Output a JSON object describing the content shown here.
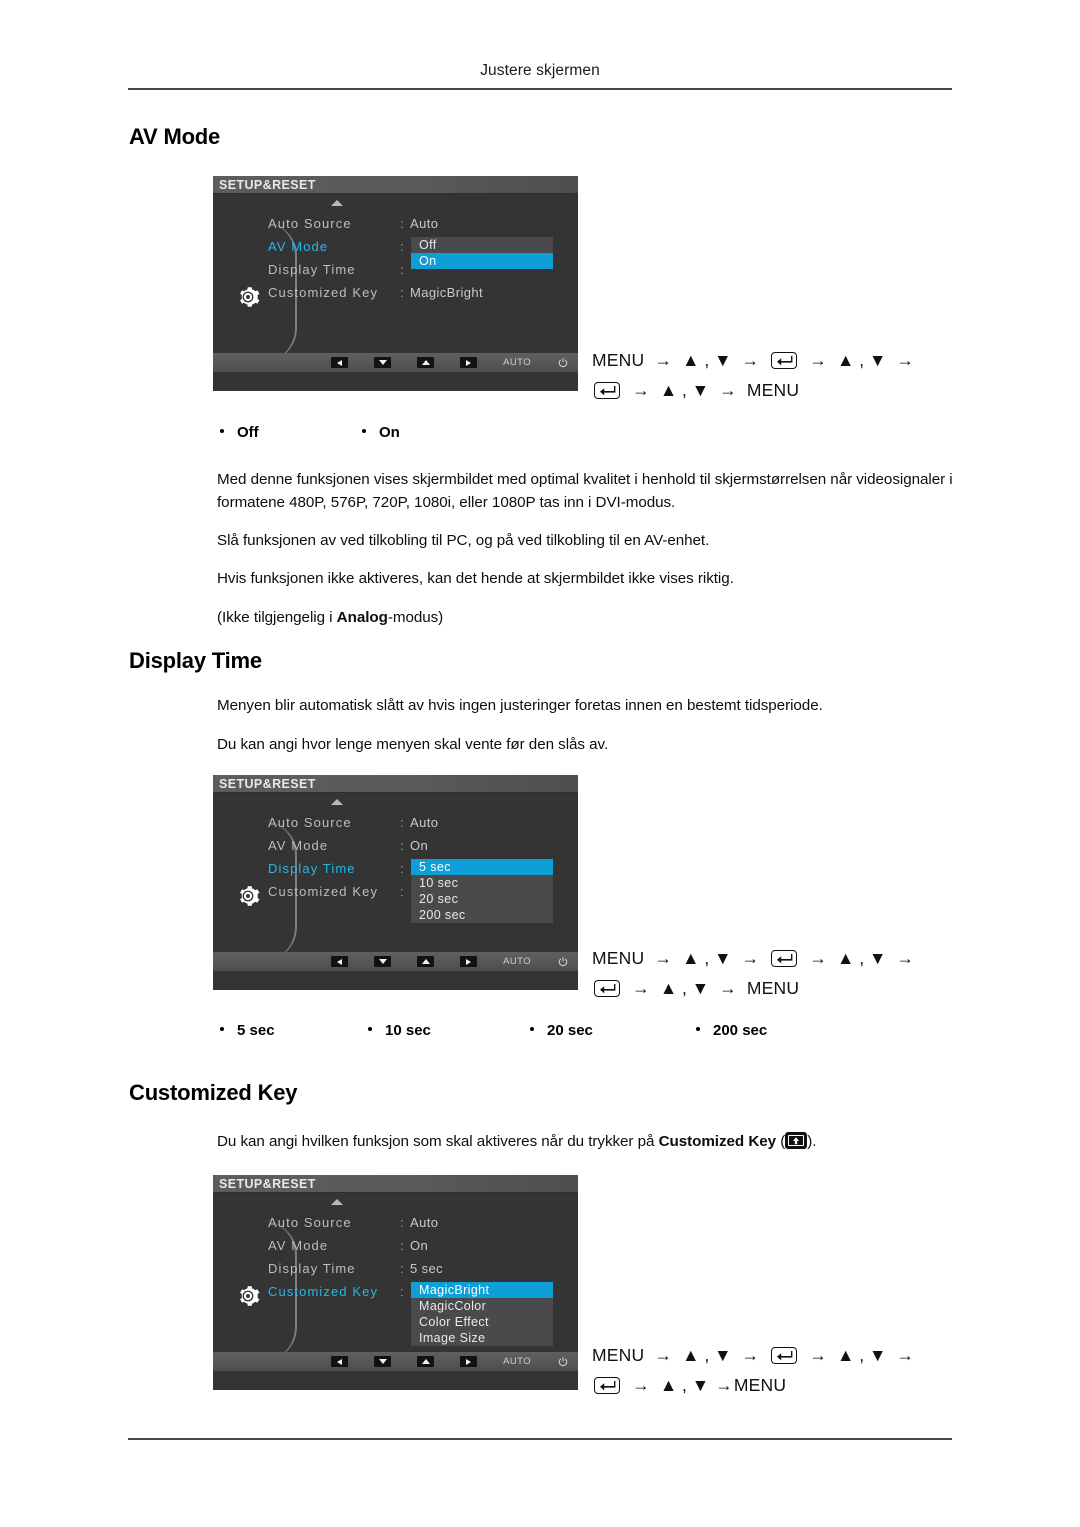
{
  "header": {
    "running_title": "Justere skjermen"
  },
  "sections": {
    "av_mode": {
      "heading": "AV Mode",
      "osd": {
        "title": "SETUP&RESET",
        "rows": [
          {
            "label": "Auto Source",
            "colon": ":",
            "value": "Auto",
            "selected": false
          },
          {
            "label": "AV Mode",
            "colon": ":",
            "value": "",
            "selected": true
          },
          {
            "label": "Display Time",
            "colon": ":",
            "value": "",
            "selected": false
          },
          {
            "label": "Customized Key",
            "colon": ":",
            "value": "MagicBright",
            "selected": false
          }
        ],
        "popup_options": [
          {
            "label": "Off",
            "highlighted": false
          },
          {
            "label": "On",
            "highlighted": true
          }
        ],
        "footer_buttons": [
          "left-icon",
          "down-icon",
          "up-icon",
          "right-icon",
          "AUTO",
          "power-icon"
        ]
      },
      "nav": {
        "line1_prefix": "MENU",
        "line1_updown": "▲ , ▼",
        "line1_updown2": "▲ , ▼",
        "line2_updown": "▲ , ▼",
        "line2_suffix": "MENU",
        "arrow": "→"
      },
      "bullets": [
        "Off",
        "On"
      ],
      "paragraphs": [
        "Med denne funksjonen vises skjermbildet med optimal kvalitet i henhold til skjermstørrelsen når videosignaler i formatene 480P, 576P, 720P, 1080i, eller 1080P tas inn i DVI-modus.",
        "Slå funksjonen av ved tilkobling til PC, og på ved tilkobling til en AV-enhet.",
        "Hvis funksjonen ikke aktiveres, kan det hende at skjermbildet ikke vises riktig."
      ],
      "note_prefix": "(Ikke tilgjengelig i ",
      "note_bold": "Analog",
      "note_suffix": "-modus)"
    },
    "display_time": {
      "heading": "Display Time",
      "paragraphs": [
        "Menyen blir automatisk slått av hvis ingen justeringer foretas innen en bestemt tidsperiode.",
        "Du kan angi hvor lenge menyen skal vente før den slås av."
      ],
      "osd": {
        "title": "SETUP&RESET",
        "rows": [
          {
            "label": "Auto Source",
            "colon": ":",
            "value": "Auto",
            "selected": false
          },
          {
            "label": "AV Mode",
            "colon": ":",
            "value": "On",
            "selected": false
          },
          {
            "label": "Display Time",
            "colon": ":",
            "value": "",
            "selected": true
          },
          {
            "label": "Customized Key",
            "colon": ":",
            "value": "",
            "selected": false
          }
        ],
        "popup_options": [
          {
            "label": "5 sec",
            "highlighted": true
          },
          {
            "label": "10 sec",
            "highlighted": false
          },
          {
            "label": "20 sec",
            "highlighted": false
          },
          {
            "label": "200 sec",
            "highlighted": false
          }
        ],
        "footer_buttons": [
          "left-icon",
          "down-icon",
          "up-icon",
          "right-icon",
          "AUTO",
          "power-icon"
        ]
      },
      "nav": {
        "line1_prefix": "MENU",
        "line1_updown": "▲ , ▼",
        "line1_updown2": "▲ , ▼",
        "line2_updown": "▲ , ▼",
        "line2_suffix": "MENU",
        "arrow": "→"
      },
      "bullets": [
        "5 sec",
        "10 sec",
        "20 sec",
        "200 sec"
      ]
    },
    "customized_key": {
      "heading": "Customized Key",
      "intro_prefix": "Du kan angi hvilken funksjon som skal aktiveres når du trykker på ",
      "intro_bold": "Customized Key",
      "intro_suffix_open": " (",
      "intro_suffix_close": ").",
      "osd": {
        "title": "SETUP&RESET",
        "rows": [
          {
            "label": "Auto Source",
            "colon": ":",
            "value": "Auto",
            "selected": false
          },
          {
            "label": "AV Mode",
            "colon": ":",
            "value": "On",
            "selected": false
          },
          {
            "label": "Display Time",
            "colon": ":",
            "value": "5 sec",
            "selected": false
          },
          {
            "label": "Customized Key",
            "colon": ":",
            "value": "",
            "selected": true
          }
        ],
        "popup_options": [
          {
            "label": "MagicBright",
            "highlighted": true
          },
          {
            "label": "MagicColor",
            "highlighted": false
          },
          {
            "label": "Color Effect",
            "highlighted": false
          },
          {
            "label": "Image Size",
            "highlighted": false
          }
        ],
        "footer_buttons": [
          "left-icon",
          "down-icon",
          "up-icon",
          "right-icon",
          "AUTO",
          "power-icon"
        ]
      },
      "nav": {
        "line1_prefix": "MENU",
        "line1_updown": "▲ , ▼",
        "line1_updown2": "▲ , ▼",
        "line2_updown": "▲ , ▼",
        "line2_suffix": "MENU",
        "arrow": "→"
      }
    }
  },
  "colors": {
    "osd_bg": "#343434",
    "osd_titlebar": "#5a5a5a",
    "highlight": "#0e9fd8",
    "selected_label": "#29b6e8",
    "popup_bg": "#4a4a4a",
    "rule": "#4a4a4a"
  },
  "labels": {
    "auto_button": "AUTO"
  }
}
